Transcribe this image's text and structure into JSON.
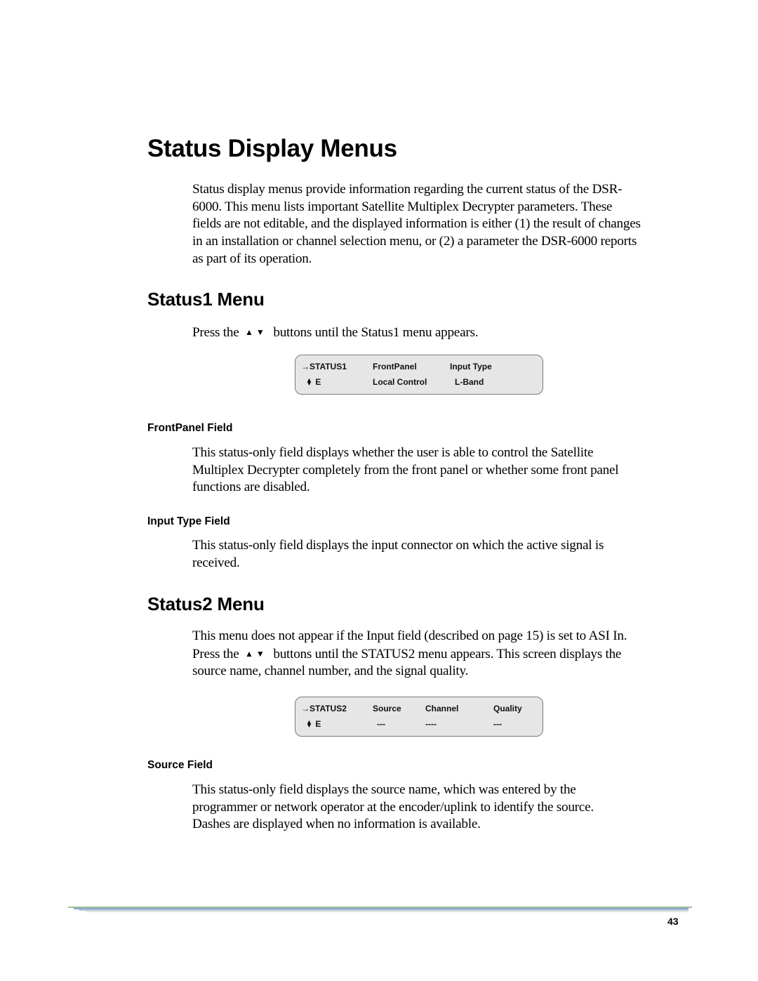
{
  "page": {
    "title": "Status Display Menus",
    "intro_lines": [
      "Status display menus provide information regarding the current status of the DSR-",
      "6000. This menu lists important Satellite Multiplex Decrypter parameters. These",
      "fields are not editable, and the displayed information is either (1) the result of changes",
      "in an installation or channel selection menu, or (2) a parameter the DSR-6000 reports",
      "as part of its operation."
    ],
    "page_number": "43"
  },
  "status1": {
    "heading": "Status1 Menu",
    "press_before": "Press the",
    "press_after": "buttons until the Status1 menu appears.",
    "arrow_glyphs": "▲▼",
    "lcd": {
      "menu_name": "STATUS1",
      "nav_arrow": "→",
      "updown": "▲▼",
      "row2_label": "E",
      "col1_header": "FrontPanel",
      "col1_value": "Local Control",
      "col2_header": "Input Type",
      "col2_value": "L-Band"
    },
    "frontpanel": {
      "heading": "FrontPanel Field",
      "lines": [
        "This status-only field displays whether the user is able to control the Satellite",
        "Multiplex Decrypter completely from the front panel or whether some front panel",
        "functions are disabled."
      ]
    },
    "inputtype": {
      "heading": "Input Type Field",
      "lines": [
        "This status-only field displays the input connector on which the active signal is",
        "received."
      ]
    }
  },
  "status2": {
    "heading": "Status2 Menu",
    "line1": "This menu does not appear if the Input field (described on page 15) is set to ASI In.",
    "press_before": "Press the",
    "press_after": "buttons until the STATUS2 menu appears. This screen displays the",
    "line3": "source name, channel number, and the signal quality.",
    "arrow_glyphs": "▲▼",
    "lcd": {
      "menu_name": "STATUS2",
      "nav_arrow": "→",
      "updown": "▲▼",
      "row2_label": "E",
      "col1_header": "Source",
      "col1_value": "---",
      "col2_header": "Channel",
      "col2_value": "----",
      "col3_header": "Quality",
      "col3_value": "---"
    },
    "source": {
      "heading": "Source Field",
      "lines": [
        "This status-only field displays the source name, which was entered by the",
        "programmer or network operator at the encoder/uplink to identify the source.",
        "Dashes are displayed when no information is available."
      ]
    }
  }
}
